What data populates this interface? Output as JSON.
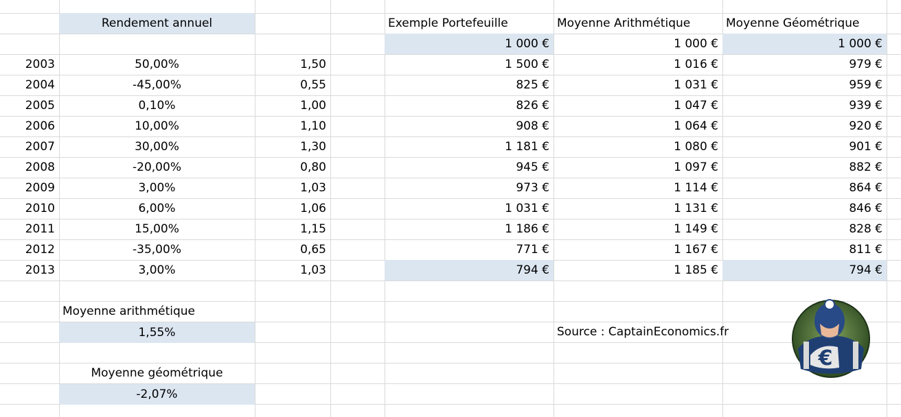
{
  "left_table": {
    "header": "Rendement annuel",
    "rows": [
      {
        "year": "2003",
        "rate": "50,00%",
        "factor": "1,50"
      },
      {
        "year": "2004",
        "rate": "-45,00%",
        "factor": "0,55"
      },
      {
        "year": "2005",
        "rate": "0,10%",
        "factor": "1,00"
      },
      {
        "year": "2006",
        "rate": "10,00%",
        "factor": "1,10"
      },
      {
        "year": "2007",
        "rate": "30,00%",
        "factor": "1,30"
      },
      {
        "year": "2008",
        "rate": "-20,00%",
        "factor": "0,80"
      },
      {
        "year": "2009",
        "rate": "3,00%",
        "factor": "1,03"
      },
      {
        "year": "2010",
        "rate": "6,00%",
        "factor": "1,06"
      },
      {
        "year": "2011",
        "rate": "15,00%",
        "factor": "1,15"
      },
      {
        "year": "2012",
        "rate": "-35,00%",
        "factor": "0,65"
      },
      {
        "year": "2013",
        "rate": "3,00%",
        "factor": "1,03"
      }
    ]
  },
  "right_table": {
    "headers": [
      "Exemple Portefeuille",
      "Moyenne Arithmétique",
      "Moyenne Géométrique"
    ],
    "initial": [
      "1 000 €",
      "1 000 €",
      "1 000 €"
    ],
    "rows": [
      [
        "1 500 €",
        "1 016 €",
        "979 €"
      ],
      [
        "825 €",
        "1 031 €",
        "959 €"
      ],
      [
        "826 €",
        "1 047 €",
        "939 €"
      ],
      [
        "908 €",
        "1 064 €",
        "920 €"
      ],
      [
        "1 181 €",
        "1 080 €",
        "901 €"
      ],
      [
        "945 €",
        "1 097 €",
        "882 €"
      ],
      [
        "973 €",
        "1 114 €",
        "864 €"
      ],
      [
        "1 031 €",
        "1 131 €",
        "846 €"
      ],
      [
        "1 186 €",
        "1 149 €",
        "828 €"
      ],
      [
        "771 €",
        "1 167 €",
        "811 €"
      ],
      [
        "794 €",
        "1 185 €",
        "794 €"
      ]
    ]
  },
  "summary": {
    "arith_label": "Moyenne arithmétique",
    "arith_value": "1,55%",
    "geo_label": "Moyenne géométrique",
    "geo_value": "-2,07%"
  },
  "source": "Source : CaptainEconomics.fr",
  "logo": {
    "icon": "captain-economics-logo",
    "letter": "€"
  },
  "colors": {
    "highlight": "#dce6f1",
    "grid": "#d9d9d9"
  }
}
